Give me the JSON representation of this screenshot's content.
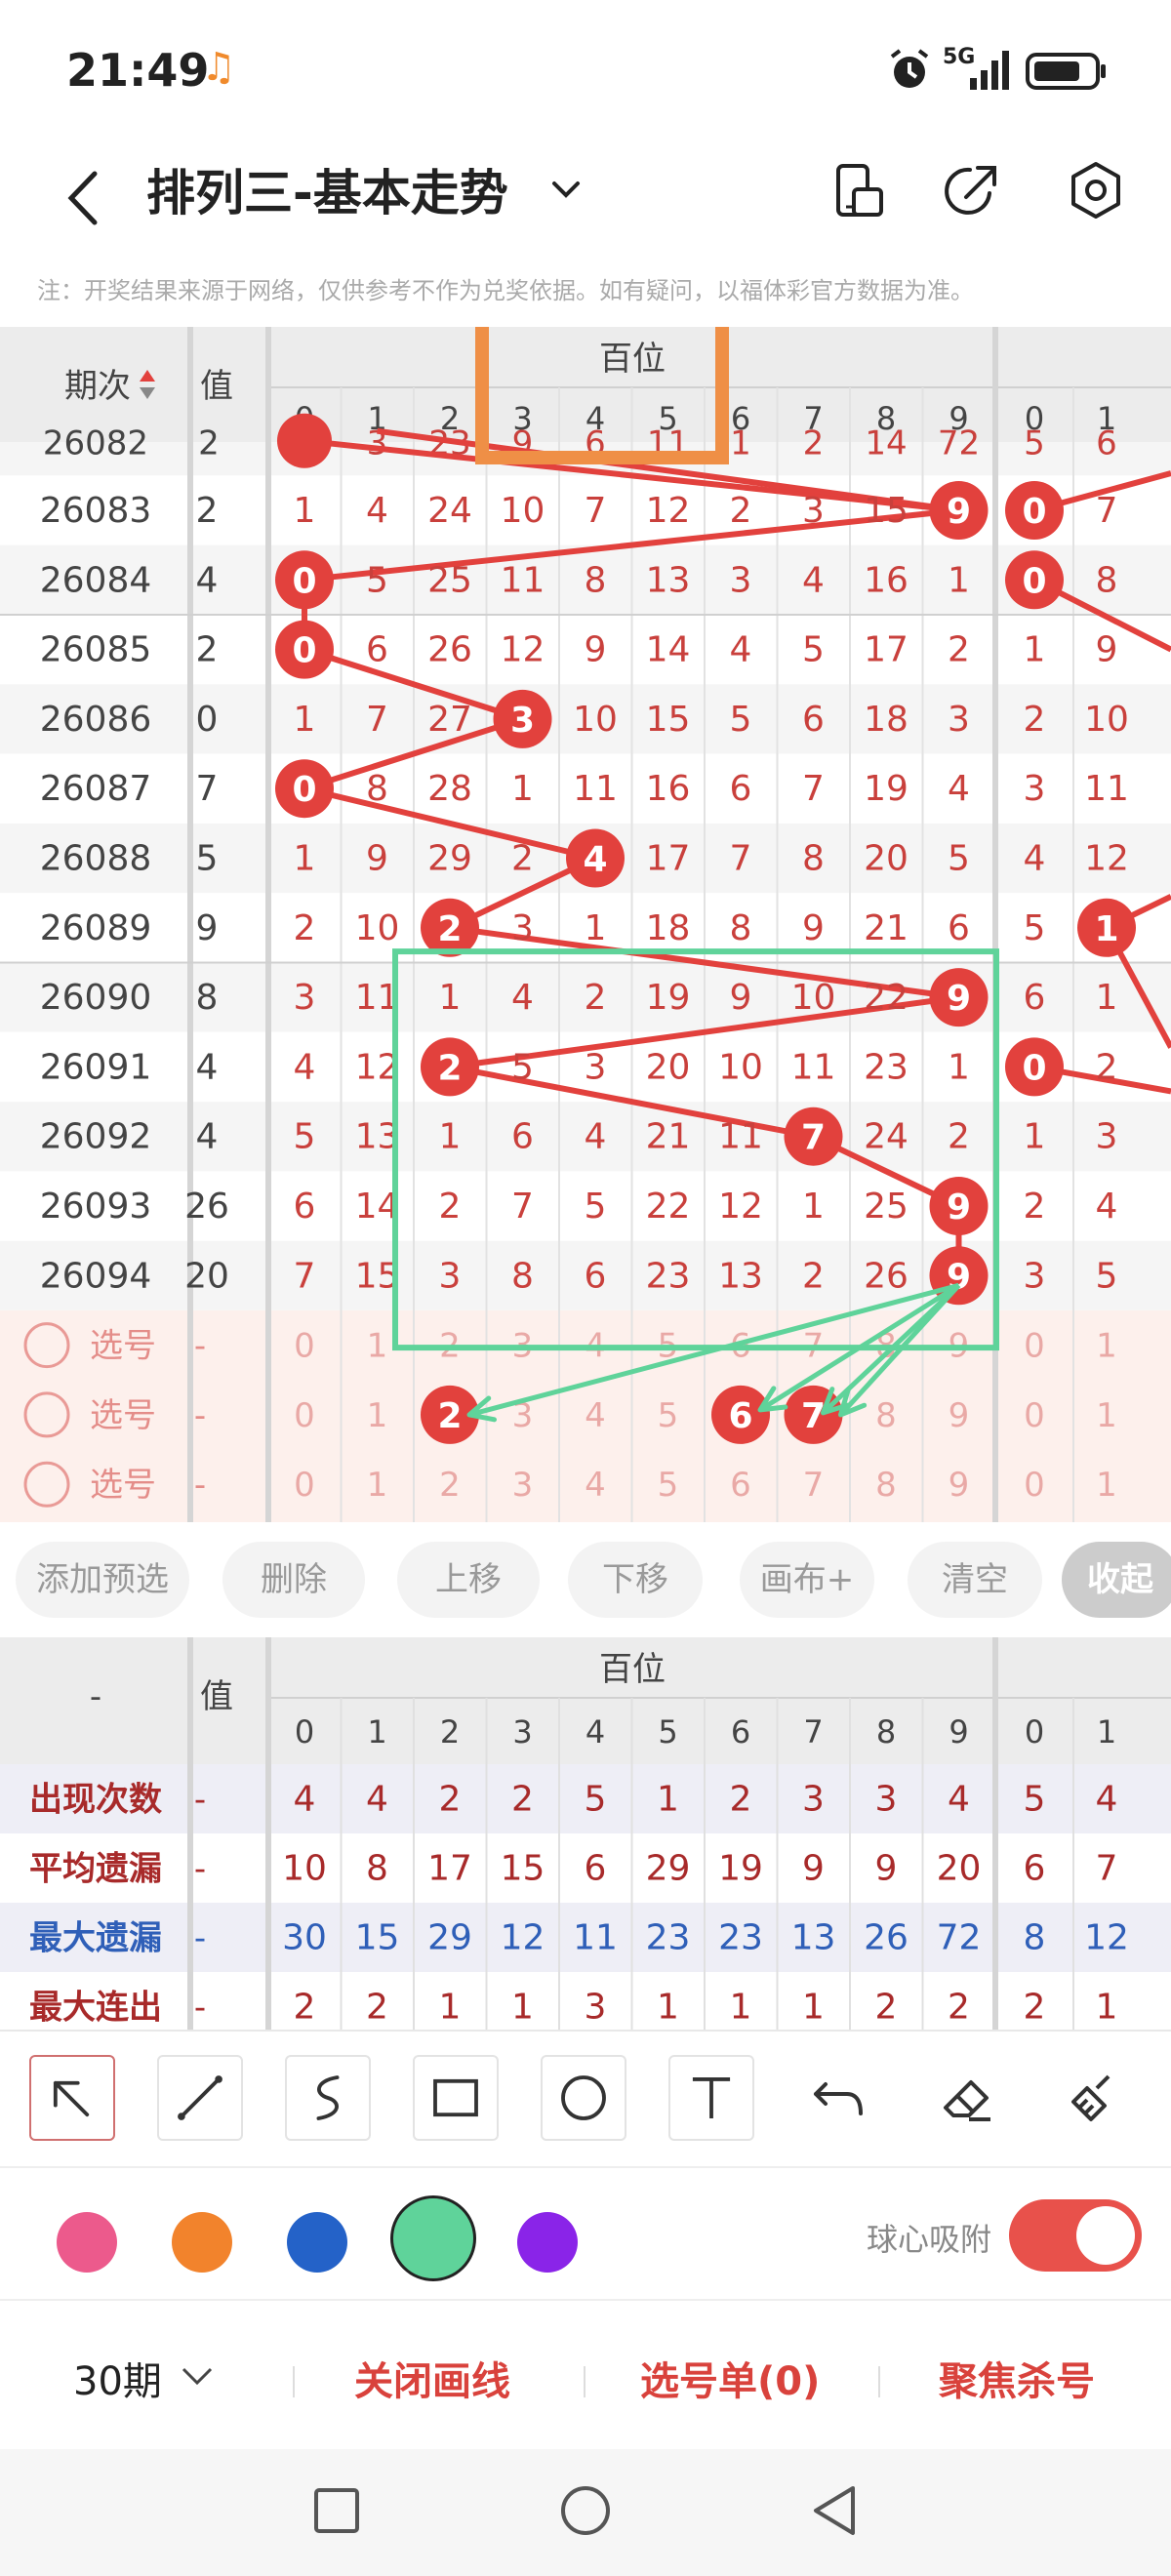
{
  "status": {
    "time": "21:49",
    "network": "5G"
  },
  "appbar": {
    "title": "排列三-基本走势"
  },
  "notice": "注：开奖结果来源于网络，仅供参考不作为兑奖依据。如有疑问，以福体彩官方数据为准。",
  "chart": {
    "col_period": "期次",
    "col_value": "值",
    "group_label": "百位",
    "digits": [
      "0",
      "1",
      "2",
      "3",
      "4",
      "5",
      "6",
      "7",
      "8",
      "9"
    ],
    "next_digits": [
      "0",
      "1"
    ],
    "partial_row": {
      "period": "26082",
      "value": "2",
      "cells": [
        "0",
        "3",
        "23",
        "9",
        "6",
        "11",
        "1",
        "2",
        "14",
        "72"
      ],
      "next": [
        "5",
        "6"
      ]
    },
    "rows": [
      {
        "period": "26083",
        "value": "2",
        "cells": [
          "1",
          "4",
          "24",
          "10",
          "7",
          "12",
          "2",
          "3",
          "15",
          "9"
        ],
        "hit": 9,
        "next": [
          "0",
          "7"
        ],
        "nextHit": 0
      },
      {
        "period": "26084",
        "value": "4",
        "cells": [
          "0",
          "5",
          "25",
          "11",
          "8",
          "13",
          "3",
          "4",
          "16",
          "1"
        ],
        "hit": 0,
        "next": [
          "0",
          "8"
        ],
        "nextHit": 0
      },
      {
        "period": "26085",
        "value": "2",
        "cells": [
          "0",
          "6",
          "26",
          "12",
          "9",
          "14",
          "4",
          "5",
          "17",
          "2"
        ],
        "hit": 0,
        "next": [
          "1",
          "9"
        ],
        "nextHit": -1
      },
      {
        "period": "26086",
        "value": "0",
        "cells": [
          "1",
          "7",
          "27",
          "3",
          "10",
          "15",
          "5",
          "6",
          "18",
          "3"
        ],
        "hit": 3,
        "next": [
          "2",
          "10"
        ],
        "nextHit": -1
      },
      {
        "period": "26087",
        "value": "7",
        "cells": [
          "0",
          "8",
          "28",
          "1",
          "11",
          "16",
          "6",
          "7",
          "19",
          "4"
        ],
        "hit": 0,
        "next": [
          "3",
          "11"
        ],
        "nextHit": -1
      },
      {
        "period": "26088",
        "value": "5",
        "cells": [
          "1",
          "9",
          "29",
          "2",
          "4",
          "17",
          "7",
          "8",
          "20",
          "5"
        ],
        "hit": 4,
        "next": [
          "4",
          "12"
        ],
        "nextHit": -1
      },
      {
        "period": "26089",
        "value": "9",
        "cells": [
          "2",
          "10",
          "2",
          "3",
          "1",
          "18",
          "8",
          "9",
          "21",
          "6"
        ],
        "hit": 2,
        "next": [
          "5",
          "1"
        ],
        "nextHit": 1
      },
      {
        "period": "26090",
        "value": "8",
        "cells": [
          "3",
          "11",
          "1",
          "4",
          "2",
          "19",
          "9",
          "10",
          "22",
          "9"
        ],
        "hit": 9,
        "next": [
          "6",
          "1"
        ],
        "nextHit": -1
      },
      {
        "period": "26091",
        "value": "4",
        "cells": [
          "4",
          "12",
          "2",
          "5",
          "3",
          "20",
          "10",
          "11",
          "23",
          "1"
        ],
        "hit": 2,
        "next": [
          "0",
          "2"
        ],
        "nextHit": 0
      },
      {
        "period": "26092",
        "value": "4",
        "cells": [
          "5",
          "13",
          "1",
          "6",
          "4",
          "21",
          "11",
          "7",
          "24",
          "2"
        ],
        "hit": 7,
        "next": [
          "1",
          "3"
        ],
        "nextHit": -1
      },
      {
        "period": "26093",
        "value": "26",
        "cells": [
          "6",
          "14",
          "2",
          "7",
          "5",
          "22",
          "12",
          "1",
          "25",
          "9"
        ],
        "hit": 9,
        "next": [
          "2",
          "4"
        ],
        "nextHit": -1
      },
      {
        "period": "26094",
        "value": "20",
        "cells": [
          "7",
          "15",
          "3",
          "8",
          "6",
          "23",
          "13",
          "2",
          "26",
          "9"
        ],
        "hit": 9,
        "next": [
          "3",
          "5"
        ],
        "nextHit": -1
      }
    ],
    "select_label": "选号",
    "select_value": "-",
    "select_rows": [
      {
        "picked": []
      },
      {
        "picked": [
          2,
          6,
          7
        ]
      },
      {
        "picked": []
      }
    ]
  },
  "actions": [
    "添加预选",
    "删除",
    "上移",
    "下移",
    "画布+",
    "清空",
    "收起"
  ],
  "summary": {
    "dash": "-",
    "col_value": "值",
    "group_label": "百位",
    "rows": [
      {
        "label": "出现次数",
        "value": "-",
        "cells": [
          "4",
          "4",
          "2",
          "2",
          "5",
          "1",
          "2",
          "3",
          "3",
          "4"
        ],
        "next": [
          "5",
          "4"
        ],
        "color": "#a82a2a"
      },
      {
        "label": "平均遗漏",
        "value": "-",
        "cells": [
          "10",
          "8",
          "17",
          "15",
          "6",
          "29",
          "19",
          "9",
          "9",
          "20"
        ],
        "next": [
          "6",
          "7"
        ],
        "color": "#a82a2a"
      },
      {
        "label": "最大遗漏",
        "value": "-",
        "cells": [
          "30",
          "15",
          "29",
          "12",
          "11",
          "23",
          "23",
          "13",
          "26",
          "72"
        ],
        "next": [
          "8",
          "12"
        ],
        "color": "#2f5fb8"
      },
      {
        "label": "最大连出",
        "value": "-",
        "cells": [
          "2",
          "2",
          "1",
          "1",
          "3",
          "1",
          "1",
          "1",
          "2",
          "2"
        ],
        "next": [
          "2",
          "1"
        ],
        "color": "#a82a2a"
      }
    ]
  },
  "tools": [
    "pointer",
    "line",
    "curve",
    "rectangle",
    "circle",
    "text",
    "undo",
    "eraser",
    "clear-all"
  ],
  "colors": [
    "#ec5a8c",
    "#f2832c",
    "#2462c8",
    "#5fd39a",
    "#8a24e8"
  ],
  "snap_label": "球心吸附",
  "bottom": {
    "period": "30期",
    "close_lines": "关闭画线",
    "pick_list": "选号单(0)",
    "focus_kill": "聚焦杀号"
  }
}
